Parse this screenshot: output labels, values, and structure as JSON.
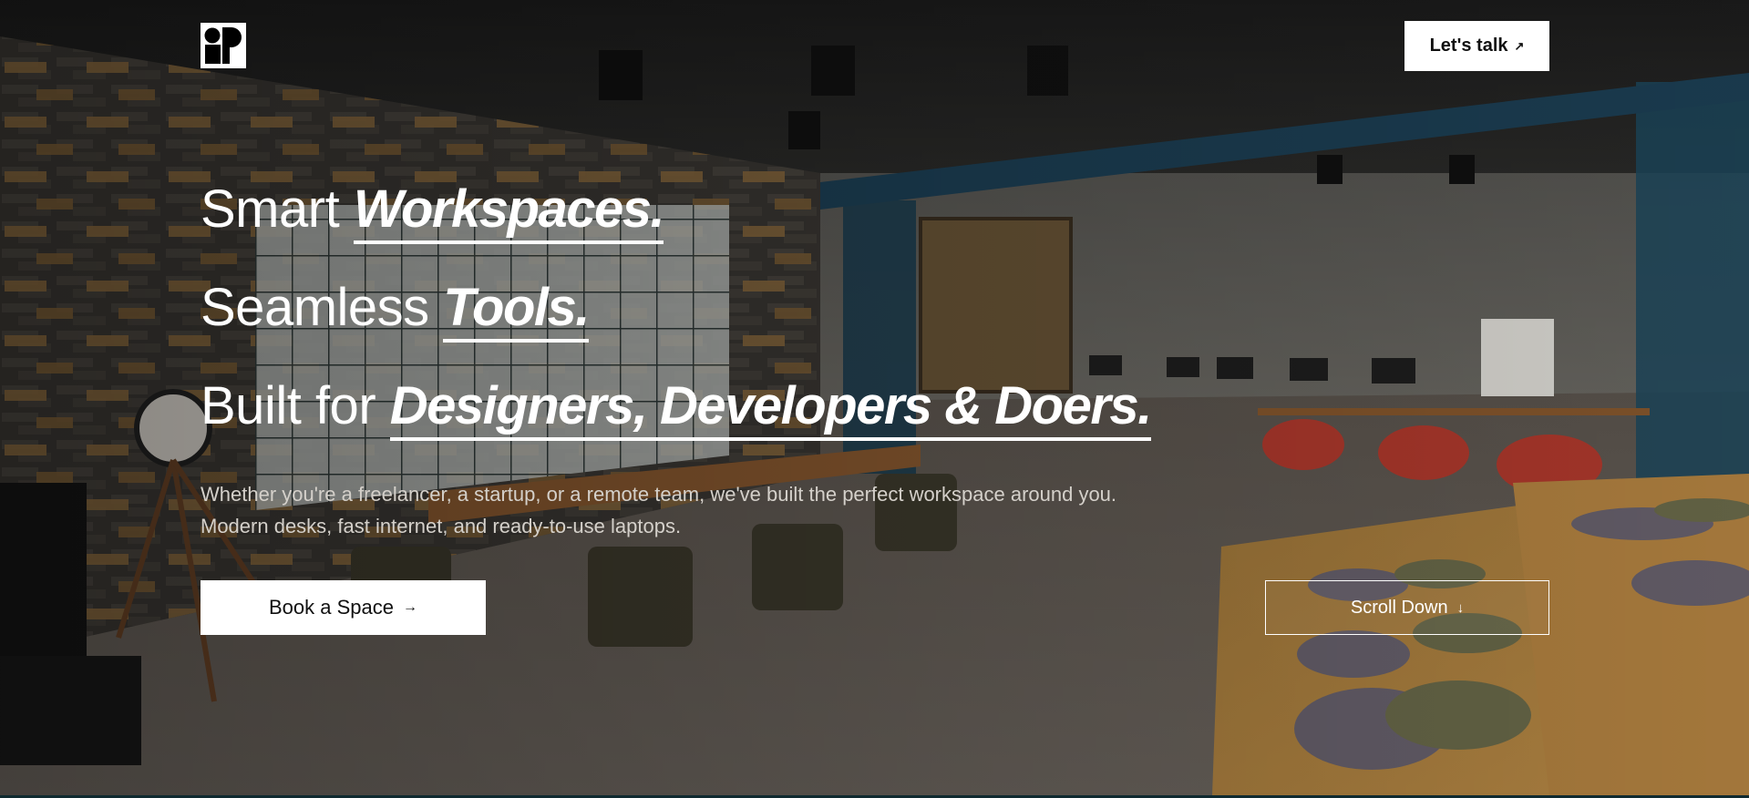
{
  "header": {
    "logo_icon": "brand-logo-icon",
    "cta_label": "Let's talk",
    "cta_icon": "arrow-up-right-icon"
  },
  "hero": {
    "line1_plain": "Smart",
    "line1_emphasis": "Workspaces.",
    "line2_plain": "Seamless",
    "line2_emphasis": "Tools.",
    "line3_plain": "Built for",
    "line3_emphasis": "Designers, Developers & Doers.",
    "description": "Whether you're a freelancer, a startup, or a remote team, we've built the perfect workspace around you. Modern desks, fast internet, and ready-to-use laptops.",
    "primary_button_label": "Book a Space",
    "primary_button_icon": "arrow-right-icon",
    "secondary_button_label": "Scroll Down",
    "secondary_button_icon": "arrow-down-icon"
  },
  "colors": {
    "text": "#ffffff",
    "button_bg": "#ffffff",
    "button_text": "#111111",
    "subtext": "#d4d0ca"
  }
}
